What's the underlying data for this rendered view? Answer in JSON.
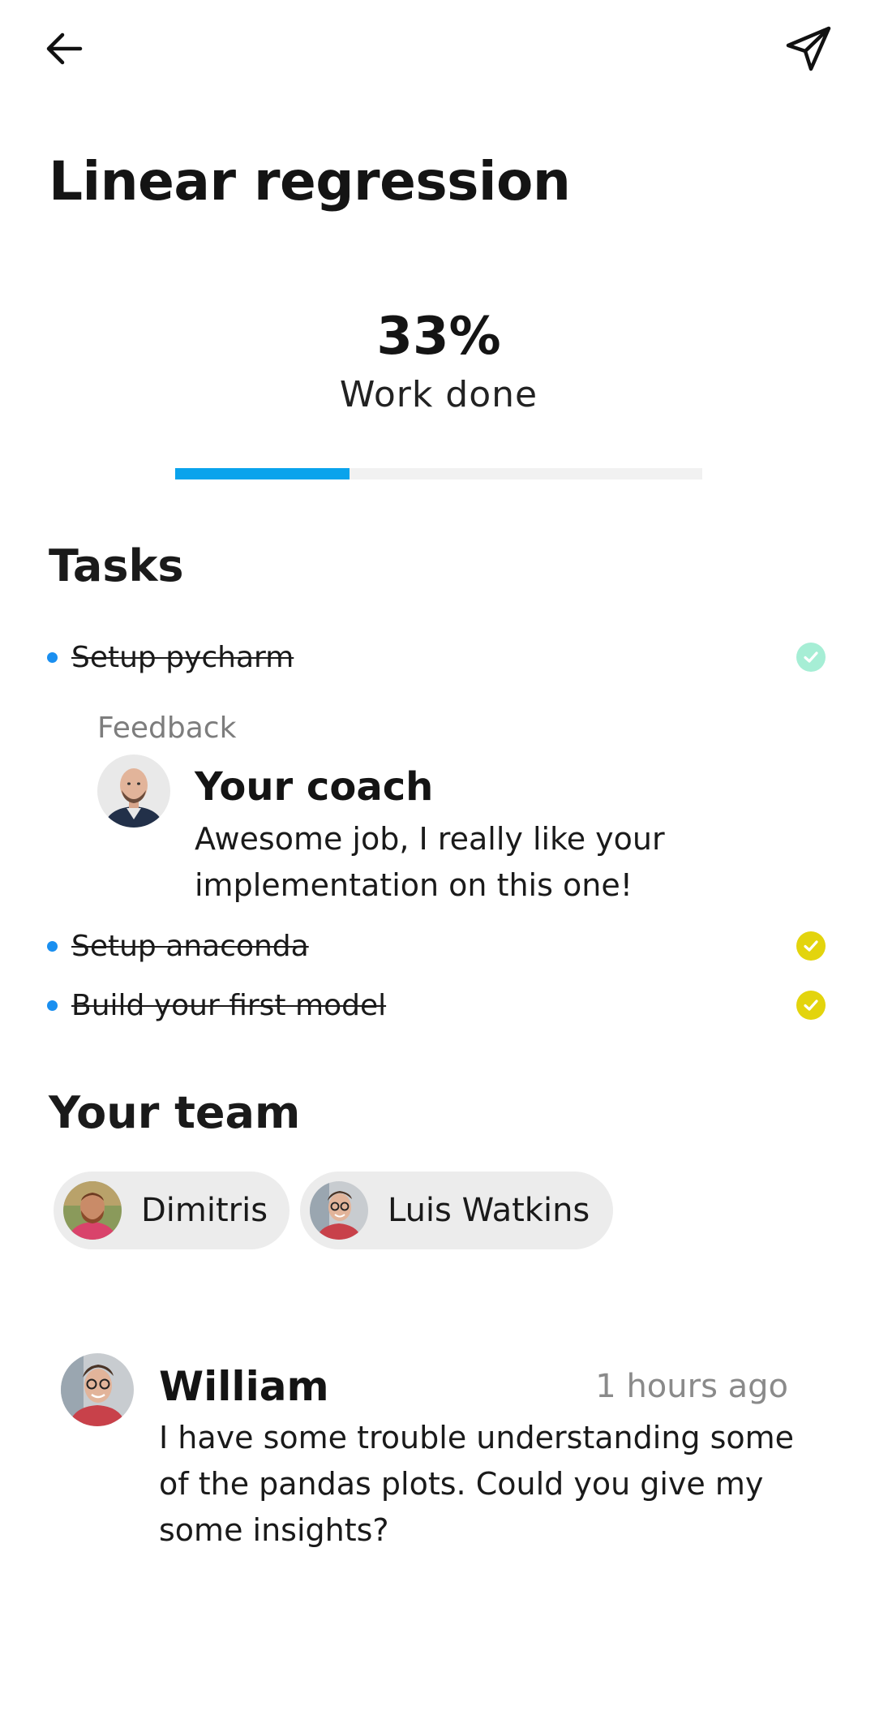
{
  "header": {
    "back_icon": "arrow-left-icon",
    "send_icon": "paper-plane-icon"
  },
  "page": {
    "title": "Linear regression"
  },
  "progress": {
    "percent_text": "33%",
    "label": "Work done",
    "fraction": 0.33,
    "fill_color": "#0aa3ec",
    "track_color": "#f1f1f1"
  },
  "tasks": {
    "title": "Tasks",
    "items": [
      {
        "label": "Setup pycharm",
        "done": true,
        "check_color": "#a6eed5"
      },
      {
        "label": "Setup anaconda",
        "done": true,
        "check_color": "#e3d40d"
      },
      {
        "label": "Build your first model",
        "done": true,
        "check_color": "#e3d40d"
      }
    ],
    "feedback": {
      "label": "Feedback",
      "author": "Your coach",
      "message": "Awesome job, I really like your implementation on this one!"
    }
  },
  "team": {
    "title": "Your team",
    "members": [
      {
        "name": "Dimitris"
      },
      {
        "name": "Luis Watkins"
      }
    ]
  },
  "comment": {
    "author": "William",
    "time": "1 hours ago",
    "body": "I have some trouble understanding some of the pandas plots. Could you give my some insights?"
  },
  "colors": {
    "bullet": "#1a8ff0",
    "chip_bg": "#ececec"
  }
}
